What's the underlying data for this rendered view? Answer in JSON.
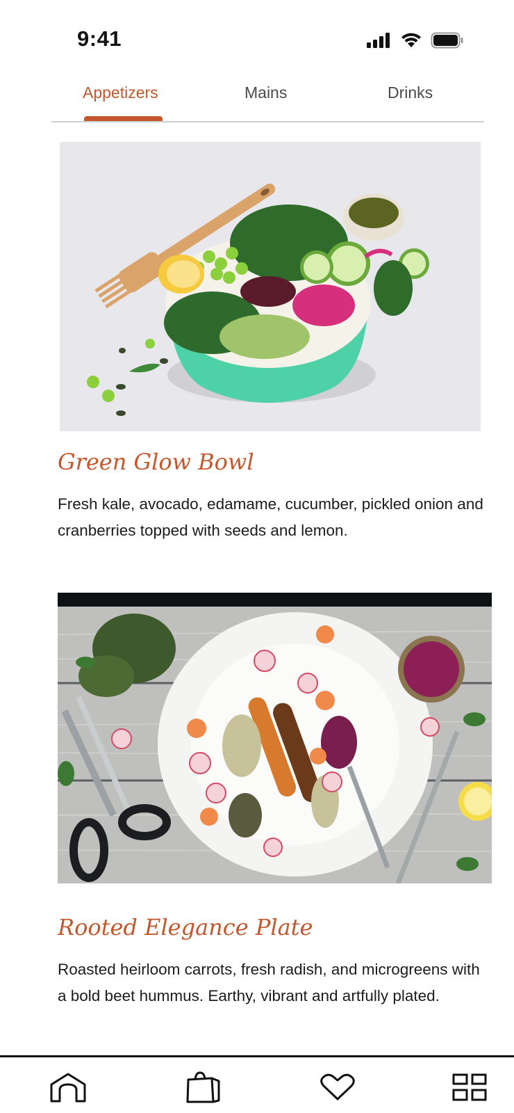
{
  "status_bar": {
    "time": "9:41",
    "icons": [
      "cellular-signal-icon",
      "wifi-icon",
      "battery-icon"
    ]
  },
  "tabs": [
    {
      "label": "Appetizers",
      "active": true
    },
    {
      "label": "Mains",
      "active": false
    },
    {
      "label": "Drinks",
      "active": false
    }
  ],
  "menu_items": [
    {
      "title": "Green Glow Bowl",
      "description": "Fresh kale, avocado, edamame, cucumber, pickled onion and cranberries topped with seeds and lemon.",
      "image": "salad-bowl-photo"
    },
    {
      "title": "Rooted Elegance Plate",
      "description": "Roasted heirloom carrots, fresh radish, and microgreens with a bold beet hummus. Earthy, vibrant and artfully plated.",
      "image": "roasted-vegetable-plate-photo"
    }
  ],
  "bottom_nav": {
    "items": [
      "home-icon",
      "shopping-bag-icon",
      "heart-icon",
      "grid-icon"
    ]
  },
  "colors": {
    "accent": "#c4572b",
    "text": "#1c1c1c",
    "tab_inactive": "#4a4a4a",
    "divider": "#cfcfcf"
  }
}
